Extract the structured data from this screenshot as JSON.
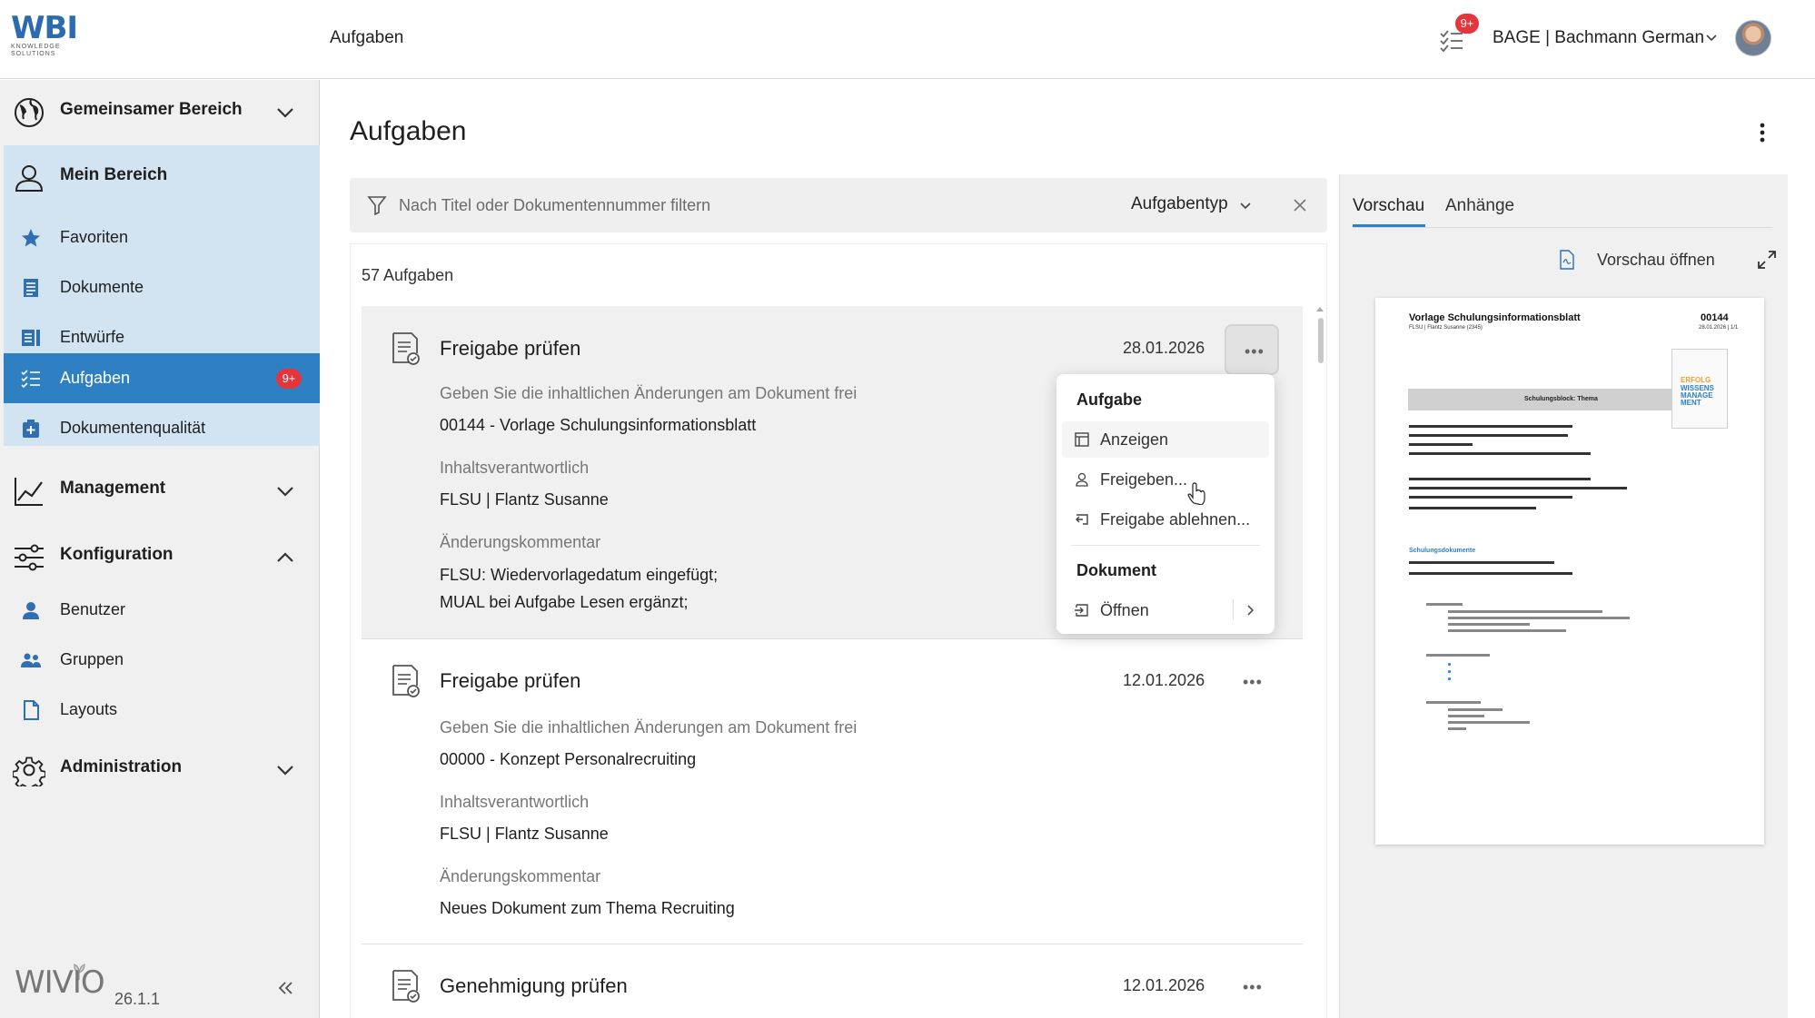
{
  "header": {
    "logo_text": "WBI",
    "logo_sub_1": "KNOWLEDGE",
    "logo_sub_2": "SOLUTIONS",
    "title": "Aufgaben",
    "task_badge": "9+",
    "user": "BAGE | Bachmann German"
  },
  "sidebar": {
    "sections": {
      "shared": "Gemeinsamer Bereich",
      "mine": "Mein Bereich",
      "management": "Management",
      "configuration": "Konfiguration",
      "administration": "Administration"
    },
    "mine_items": [
      "Favoriten",
      "Dokumente",
      "Entwürfe",
      "Aufgaben",
      "Dokumentenqualität"
    ],
    "tasks_badge": "9+",
    "config_items": [
      "Benutzer",
      "Gruppen",
      "Layouts"
    ],
    "footer_logo": "WIVIO",
    "version": "26.1.1"
  },
  "main": {
    "title": "Aufgaben",
    "filter_placeholder": "Nach Titel oder Dokumentennummer filtern",
    "type_filter": "Aufgabentyp",
    "count": "57 Aufgaben",
    "tasks": [
      {
        "title": "Freigabe prüfen",
        "date": "28.01.2026",
        "desc_label": "Geben Sie die inhaltlichen Änderungen am Dokument frei",
        "document": "00144 - Vorlage Schulungsinformationsblatt",
        "owner_label": "Inhaltsverantwortlich",
        "owner": "FLSU | Flantz Susanne",
        "comment_label": "Änderungskommentar",
        "comment_1": "FLSU: Wiedervorlagedatum eingefügt;",
        "comment_2": "MUAL bei Aufgabe Lesen ergänzt;"
      },
      {
        "title": "Freigabe prüfen",
        "date": "12.01.2026",
        "desc_label": "Geben Sie die inhaltlichen Änderungen am Dokument frei",
        "document": "00000 - Konzept Personalrecruiting",
        "owner_label": "Inhaltsverantwortlich",
        "owner": "FLSU | Flantz Susanne",
        "comment_label": "Änderungskommentar",
        "comment_1": "Neues Dokument zum Thema Recruiting"
      },
      {
        "title": "Genehmigung prüfen",
        "date": "12.01.2026"
      }
    ],
    "more_glyph": "•••"
  },
  "context_menu": {
    "task_header": "Aufgabe",
    "task_items": [
      "Anzeigen",
      "Freigeben...",
      "Freigabe ablehnen..."
    ],
    "doc_header": "Dokument",
    "doc_items": [
      "Öffnen"
    ]
  },
  "preview": {
    "tabs": [
      "Vorschau",
      "Anhänge"
    ],
    "open_label": "Vorschau öffnen",
    "doc_title": "Vorlage Schulungsinformationsblatt",
    "doc_sub": "FLSU | Flantz Susanne (2345)",
    "doc_number": "00144",
    "doc_date": "28.01.2026 | 1/1",
    "doc_band": "Schulungsblock: Thema",
    "doc_img_1": "ERFOLG",
    "doc_img_2": "WISSENS MANAGE MENT",
    "doc_section": "Schulungsdokumente"
  },
  "colors": {
    "accent": "#2f80c3",
    "badge": "#e5353c",
    "sidebar_active_bg": "#d2e4f1"
  }
}
